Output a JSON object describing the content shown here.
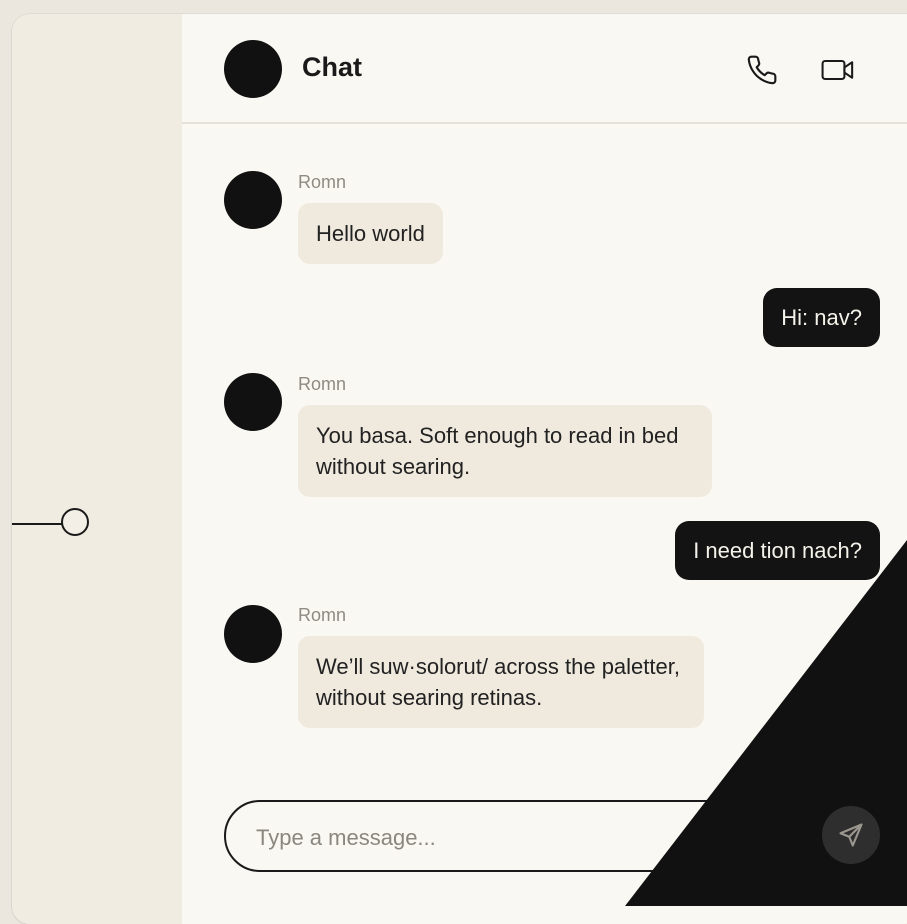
{
  "header": {
    "title": "Chat"
  },
  "icons": {
    "phone": "phone-icon",
    "video": "video-camera-icon",
    "send": "send-icon"
  },
  "messages": [
    {
      "direction": "incoming",
      "sender": "Romn",
      "text": "Hello world"
    },
    {
      "direction": "outgoing",
      "text": "Hi: nav?"
    },
    {
      "direction": "incoming",
      "sender": "Romn",
      "text": "You basa. Soft enough to read in bed without searing."
    },
    {
      "direction": "outgoing",
      "text": "I need tion nach?"
    },
    {
      "direction": "incoming",
      "sender": "Romn",
      "text": "We’ll suw·solorut/ across the paletter, without searing retinas."
    }
  ],
  "composer": {
    "placeholder": "Type a message...",
    "value": ""
  },
  "colors": {
    "background": "#ebe7df",
    "panel": "#faf8f2",
    "sidebar": "#f1ece2",
    "incoming_bubble": "#efe9de",
    "outgoing_bubble": "#131313",
    "accent": "#111111"
  }
}
